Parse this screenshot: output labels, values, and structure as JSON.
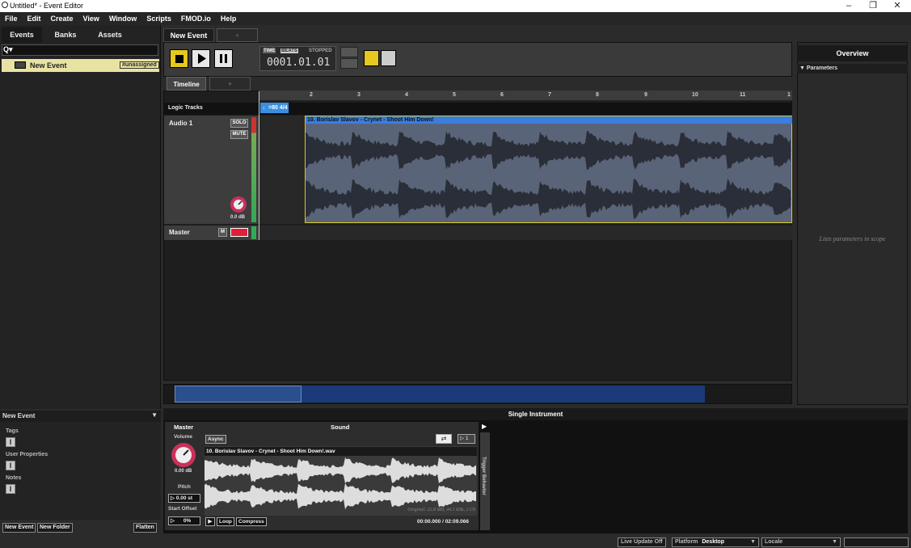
{
  "window": {
    "title": "Untitled* - Event Editor"
  },
  "menu": [
    "File",
    "Edit",
    "Create",
    "View",
    "Window",
    "Scripts",
    "FMOD.io",
    "Help"
  ],
  "left_tabs": [
    "Events",
    "Banks",
    "Assets"
  ],
  "event_item": {
    "name": "New Event",
    "badge": "#unassigned"
  },
  "props": {
    "title": "New Event",
    "tags": "Tags",
    "user_props": "User Properties",
    "notes": "Notes",
    "field_glyph": "I"
  },
  "left_buttons": {
    "new_event": "New Event",
    "new_folder": "New Folder",
    "flatten": "Flatten"
  },
  "editor_tab": "New Event",
  "plus": "+",
  "transport": {
    "time": "TIME",
    "beats": "BEATS",
    "status": "STOPPED",
    "position": "0001.01.01"
  },
  "timeline_tab": "Timeline",
  "ruler_ticks": [
    "2",
    "3",
    "4",
    "5",
    "6",
    "7",
    "8",
    "9",
    "10",
    "11",
    "1"
  ],
  "logic_tracks": "Logic Tracks",
  "tempo_marker": "♩=80 4/4",
  "audio_track": {
    "name": "Audio 1",
    "solo": "SOLO",
    "mute": "MUTE",
    "volume": "0.0 dB"
  },
  "master_track": {
    "name": "Master",
    "m": "M"
  },
  "clip": {
    "name": "10. Borislav Slavov - Crynet - Shoot Him Down!"
  },
  "overview": {
    "title": "Overview",
    "params": "Parameters",
    "hint": "Lists parameters in scope"
  },
  "single_instrument": {
    "title": "Single Instrument",
    "master": "Master",
    "sound": "Sound",
    "volume_label": "Volume",
    "volume": "0.00 dB",
    "pitch_label": "Pitch",
    "pitch": "0.00 st",
    "start_offset_label": "Start Offset",
    "start_offset": "0%",
    "async": "Async",
    "loop_count": "1",
    "file": "10. Borislav Slavov - Crynet - Shoot Him Down!.wav",
    "original": "Original: 22.8 MB, 44.1 kHz, 2 Ch",
    "loop": "Loop",
    "compress": "Compress",
    "time": "00:00.000 / 02:09.066",
    "trigger": "Trigger Behavior"
  },
  "footer": {
    "live_update": "Live Update Off",
    "platform": "Platform",
    "platform_value": "Desktop",
    "locale": "Locale"
  },
  "colors": {
    "accent_yellow": "#e6c81e",
    "clip_blue": "#3a7ee0",
    "mute_red": "#e0203a"
  }
}
